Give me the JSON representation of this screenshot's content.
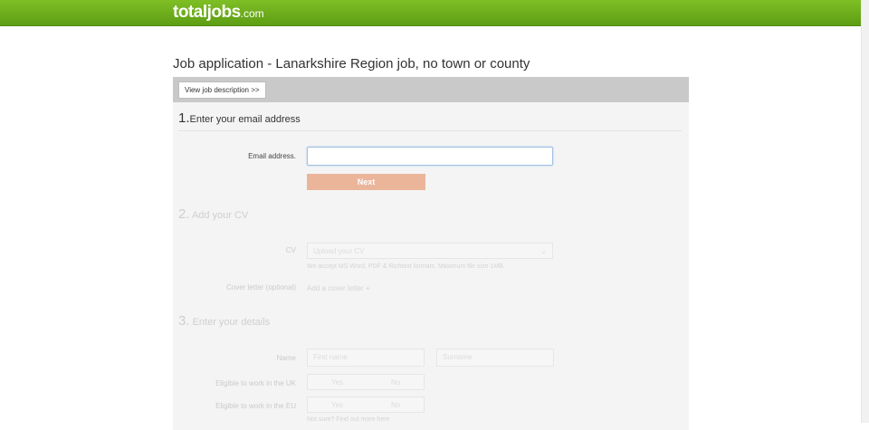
{
  "header": {
    "logo_main": "totaljobs",
    "logo_suffix": ".com"
  },
  "page": {
    "title": "Job application - Lanarkshire Region job, no town or county",
    "view_job_label": "View job description >>"
  },
  "step1": {
    "number": "1.",
    "title": "Enter your email address",
    "email_label": "Email address.",
    "email_value": "",
    "email_placeholder": "",
    "next_label": "Next"
  },
  "step2": {
    "number": "2.",
    "title": "Add your CV",
    "cv_label": "CV",
    "cv_select_value": "Upload your CV",
    "cv_hint": "We accept MS Word, PDF & Richtext formats. Maximum file size 1MB.",
    "cover_label": "Cover letter (optional)",
    "cover_link": "Add a cover letter +"
  },
  "step3": {
    "number": "3.",
    "title": "Enter your details",
    "name_label": "Name",
    "first_name_placeholder": "First name",
    "surname_placeholder": "Surname",
    "uk_label": "Eligible to work in the UK",
    "eu_label": "Eligible to work in the EU",
    "yes_label": "Yes",
    "no_label": "No",
    "eligibility_link": "Not sure? Find out more here"
  },
  "colors": {
    "brand_green": "#6aad1a",
    "next_button": "#ebb59a"
  }
}
